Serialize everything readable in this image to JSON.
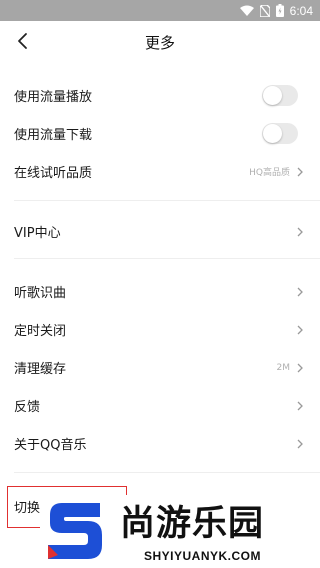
{
  "status_bar": {
    "time": "6:04"
  },
  "header": {
    "title": "更多"
  },
  "settings": {
    "cellular_play": {
      "label": "使用流量播放",
      "enabled": false
    },
    "cellular_download": {
      "label": "使用流量下载",
      "enabled": false
    },
    "audition_quality": {
      "label": "在线试听品质",
      "value": "HQ高品质"
    }
  },
  "vip": {
    "label": "VIP中心"
  },
  "tools": {
    "song_recognition": "听歌识曲",
    "sleep_timer": "定时关闭",
    "clear_cache": {
      "label": "清理缓存",
      "value": "2M"
    },
    "feedback": "反馈",
    "about": "关于QQ音乐"
  },
  "switch_account": {
    "label": "切换"
  },
  "watermark": {
    "text": "尚游乐园",
    "subtext": "SHYIYUANYK.COM",
    "accent_color": "#1d4fd6"
  }
}
